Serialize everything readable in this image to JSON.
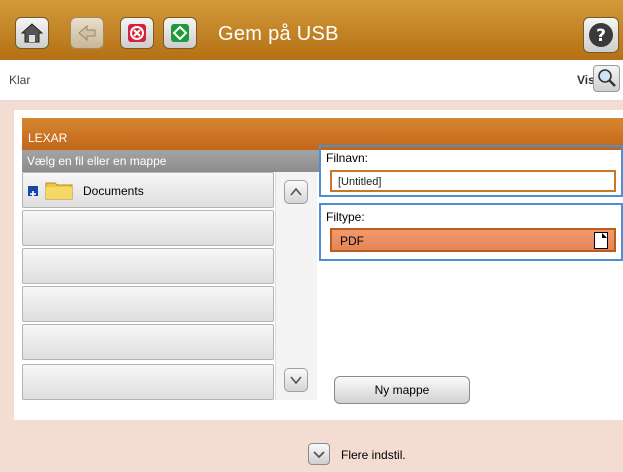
{
  "header": {
    "title": "Gem på USB",
    "icons": [
      "home-icon",
      "back-icon",
      "stop-icon",
      "start-icon",
      "help-icon"
    ]
  },
  "status": {
    "text": "Klar",
    "view_label": "Vis"
  },
  "device": {
    "name": "LEXAR",
    "list_header": "Vælg en fil eller en mappe",
    "items": [
      {
        "label": "Documents",
        "type": "folder"
      },
      {
        "label": ""
      },
      {
        "label": ""
      },
      {
        "label": ""
      },
      {
        "label": ""
      },
      {
        "label": ""
      }
    ]
  },
  "file": {
    "name_label": "Filnavn:",
    "name_value": "[Untitled]",
    "type_label": "Filtype:",
    "type_value": "PDF"
  },
  "buttons": {
    "new_folder": "Ny mappe",
    "more_options": "Flere indstil."
  },
  "colors": {
    "accent": "#c46a1f",
    "highlight_border": "#4d8fd0",
    "selected_field": "#ec8f63"
  }
}
